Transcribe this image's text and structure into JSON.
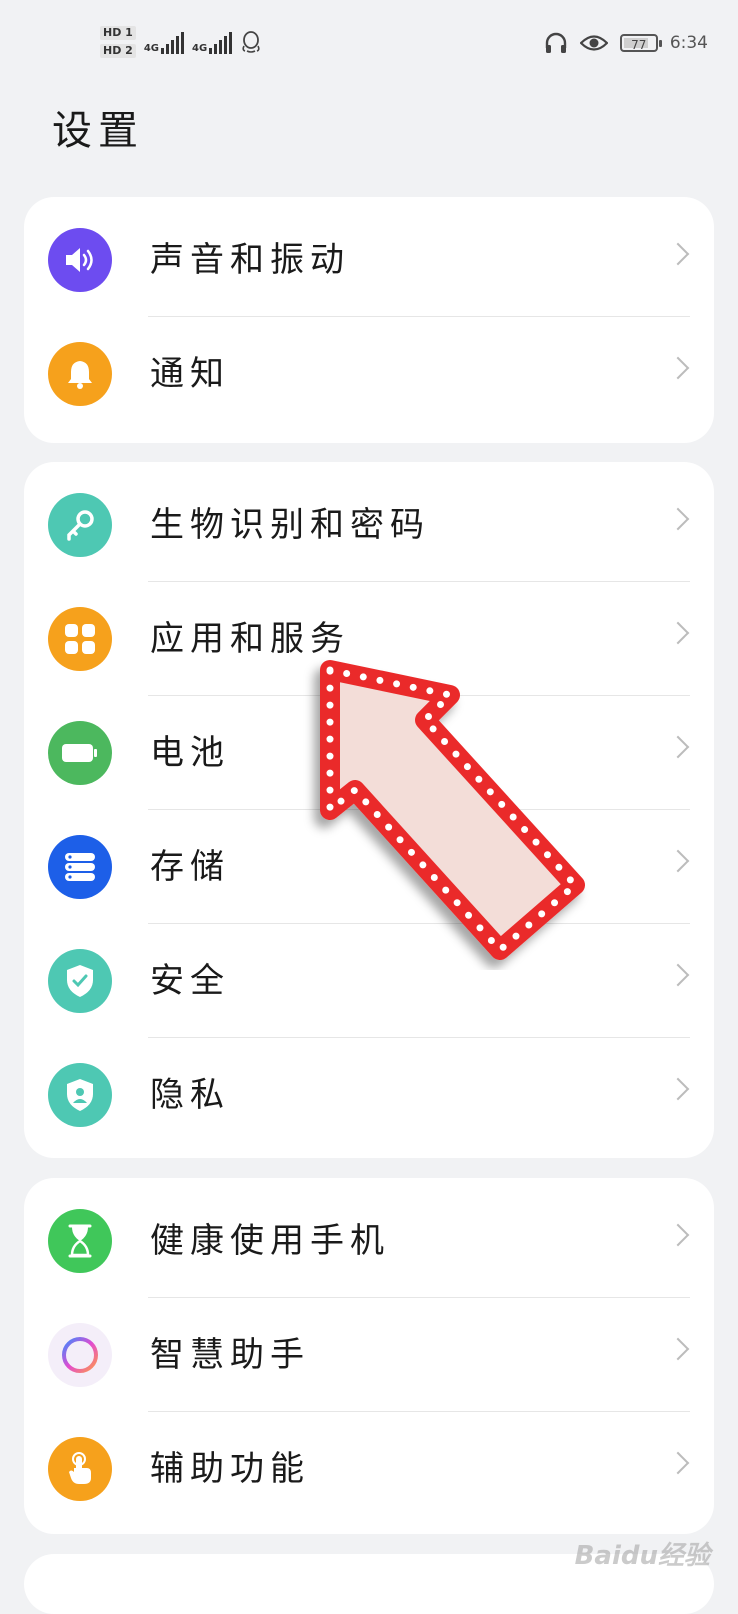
{
  "status_bar": {
    "sim1": "HD 1",
    "sim2": "HD 2",
    "net1": "4G",
    "net2": "4G",
    "battery": "77",
    "time": "6:34"
  },
  "page": {
    "title": "设置"
  },
  "groups": [
    {
      "items": [
        {
          "label": "声音和振动",
          "icon": "speaker-icon",
          "color": "#6d4cf0"
        },
        {
          "label": "通知",
          "icon": "bell-icon",
          "color": "#f6a11c"
        }
      ]
    },
    {
      "items": [
        {
          "label": "生物识别和密码",
          "icon": "key-icon",
          "color": "#4ec8b3"
        },
        {
          "label": "应用和服务",
          "icon": "apps-grid-icon",
          "color": "#f6a11c"
        },
        {
          "label": "电池",
          "icon": "battery-icon",
          "color": "#4cb85e"
        },
        {
          "label": "存储",
          "icon": "storage-icon",
          "color": "#1d5fe8"
        },
        {
          "label": "安全",
          "icon": "shield-check-icon",
          "color": "#4ec8b3"
        },
        {
          "label": "隐私",
          "icon": "privacy-shield-icon",
          "color": "#4ec8b3"
        }
      ]
    },
    {
      "items": [
        {
          "label": "健康使用手机",
          "icon": "hourglass-icon",
          "color": "#40c75a"
        },
        {
          "label": "智慧助手",
          "icon": "assistant-ring-icon",
          "color": "#f4eef9"
        },
        {
          "label": "辅助功能",
          "icon": "hand-tap-icon",
          "color": "#f6a11c"
        }
      ]
    }
  ],
  "watermark": "Baidu经验"
}
